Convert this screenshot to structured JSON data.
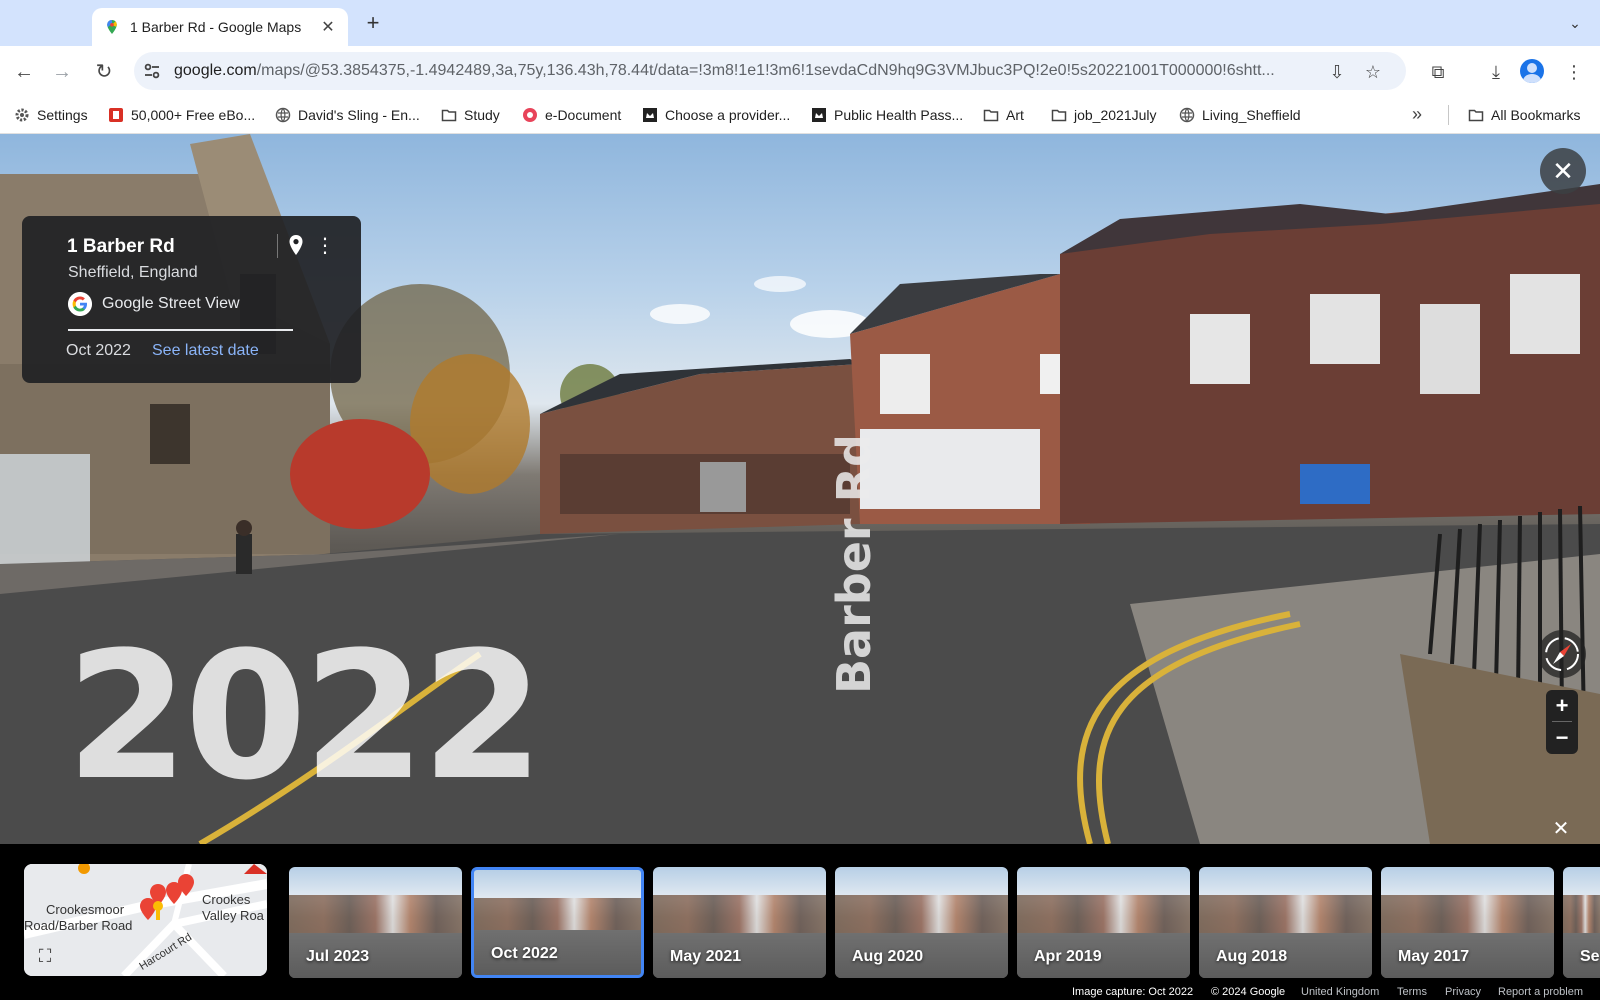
{
  "tab": {
    "title": "1 Barber Rd - Google Maps",
    "close": "✕"
  },
  "newtab": "+",
  "url": {
    "host": "google.com",
    "path": "/maps/@53.3854375,-1.4942489,3a,75y,136.43h,78.44t/data=!3m8!1e1!3m6!1sevdaCdN9hq9G3VMJbuc3PQ!2e0!5s20221001T000000!6shtt..."
  },
  "bookmarks": [
    {
      "label": "Settings",
      "icon": "gear-icon"
    },
    {
      "label": "50,000+ Free eBo...",
      "icon": "book-icon"
    },
    {
      "label": "David's Sling - En...",
      "icon": "globe-icon"
    },
    {
      "label": "Study",
      "icon": "folder-icon"
    },
    {
      "label": "e-Document",
      "icon": "document-icon"
    },
    {
      "label": "Choose a provider...",
      "icon": "crown-icon"
    },
    {
      "label": "Public Health Pass...",
      "icon": "crown-icon"
    },
    {
      "label": "Art",
      "icon": "folder-icon"
    },
    {
      "label": "job_2021July",
      "icon": "folder-icon"
    },
    {
      "label": "Living_Sheffield",
      "icon": "globe-icon"
    },
    {
      "label": "All Bookmarks",
      "icon": "folder-icon"
    }
  ],
  "infocard": {
    "address": "1 Barber Rd",
    "city": "Sheffield, England",
    "source": "Google Street View",
    "date": "Oct 2022",
    "latest_link": "See latest date"
  },
  "scene": {
    "year_overlay": "2022",
    "road_label": "Barber Rd"
  },
  "controls": {
    "close": "✕",
    "zoom_in": "+",
    "zoom_out": "−",
    "close_strip": "✕"
  },
  "minimap": {
    "labels": [
      "Crookesmoor",
      "Road/Barber Road",
      "Crookes",
      "Valley Roa",
      "Harcourt Rd"
    ]
  },
  "timeline": [
    {
      "label": "Jul 2023",
      "selected": false
    },
    {
      "label": "Oct 2022",
      "selected": true
    },
    {
      "label": "May 2021",
      "selected": false
    },
    {
      "label": "Aug 2020",
      "selected": false
    },
    {
      "label": "Apr 2019",
      "selected": false
    },
    {
      "label": "Aug 2018",
      "selected": false
    },
    {
      "label": "May 2017",
      "selected": false
    },
    {
      "label": "Se",
      "selected": false
    }
  ],
  "footer": {
    "capture": "Image capture: Oct 2022",
    "copyright": "© 2024 Google",
    "region": "United Kingdom",
    "terms": "Terms",
    "privacy": "Privacy",
    "report": "Report a problem"
  },
  "colors": {
    "accent": "#4285f4",
    "link": "#8ab4f8",
    "tabstrip": "#d3e3fd"
  }
}
